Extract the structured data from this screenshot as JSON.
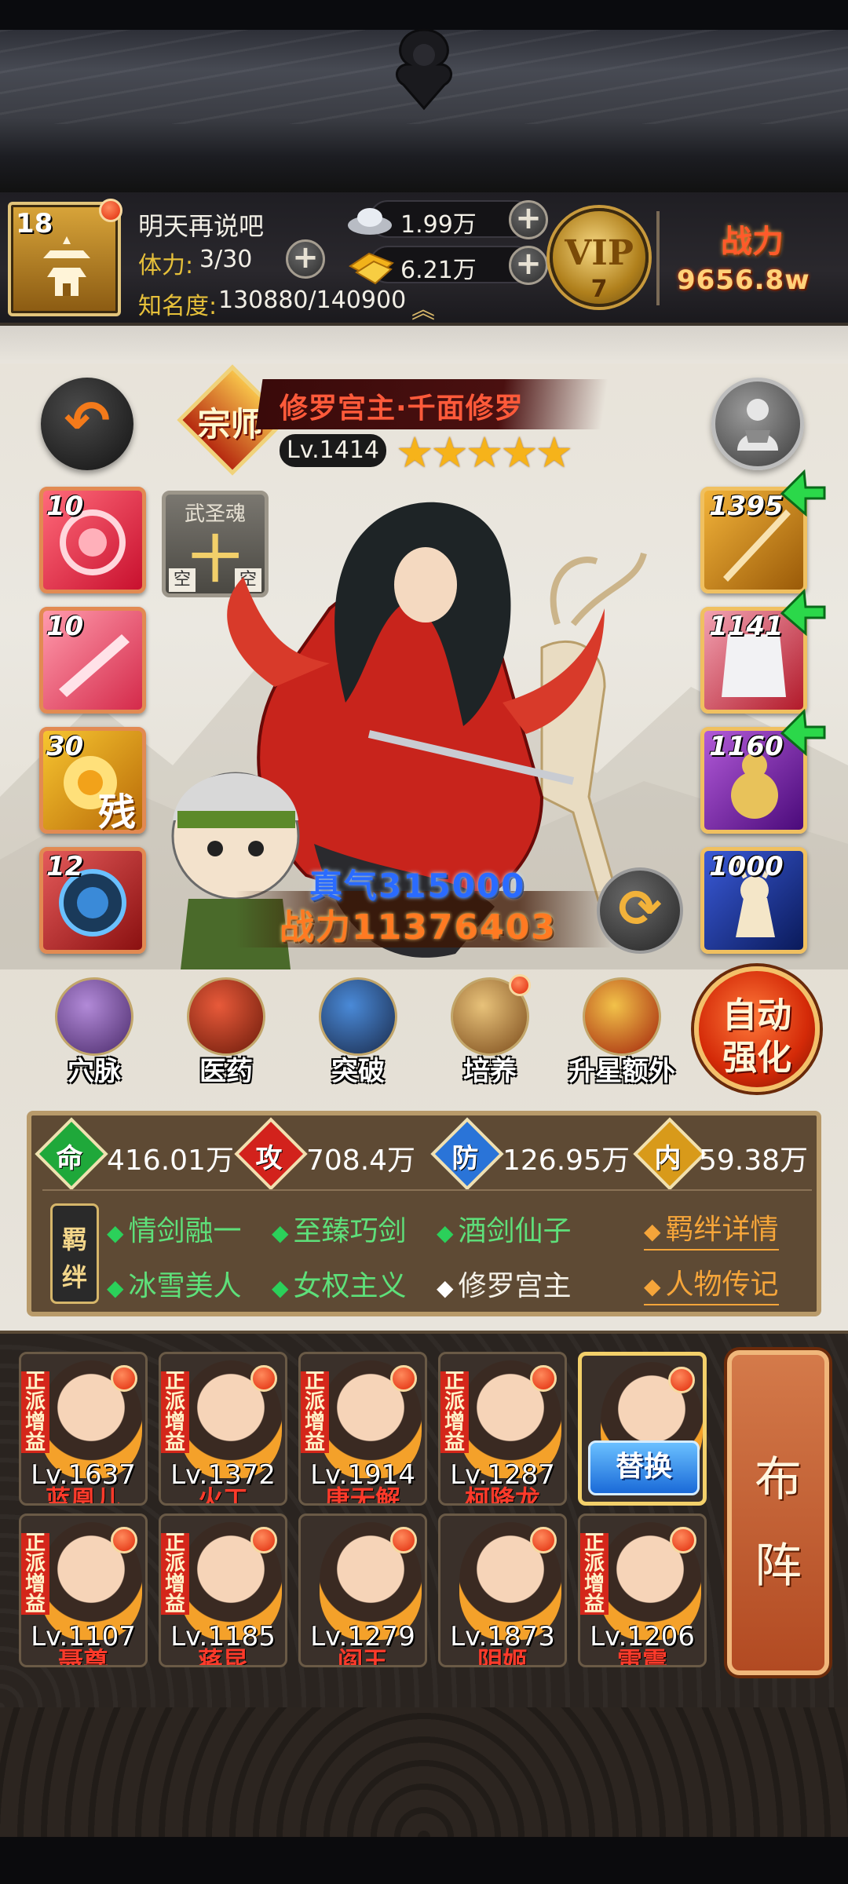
{
  "player": {
    "level": "18",
    "name": "明天再说吧",
    "stamina_label": "体力:",
    "stamina_value": "3/30",
    "fame_label": "知名度:",
    "fame_value": "130880/140900",
    "silver": "1.99万",
    "gold": "6.21万",
    "vip_text": "VIP",
    "vip_level": "7",
    "power_label": "战力",
    "power_value": "9656.8w"
  },
  "hero": {
    "rank_badge": "宗师",
    "name": "修罗宫主·千面修罗",
    "level": "Lv.1414",
    "stars": "★★★★★",
    "star_count": 5,
    "true_qi": "真气315000",
    "power": "战力11376403"
  },
  "left_slots": [
    {
      "num": "10",
      "mark": ""
    },
    {
      "num": "10",
      "mark": ""
    },
    {
      "num": "30",
      "mark": "残"
    },
    {
      "num": "12",
      "mark": ""
    }
  ],
  "martial_soul": {
    "title": "武圣魂",
    "char": "十",
    "left_key": "空",
    "right_key": "空"
  },
  "right_slots": [
    {
      "num": "1395",
      "upgrade": true
    },
    {
      "num": "1141",
      "upgrade": true
    },
    {
      "num": "1160",
      "upgrade": true
    },
    {
      "num": "1000",
      "upgrade": false
    }
  ],
  "actions": [
    {
      "label": "穴脉",
      "icon": "meridian-icon",
      "dot": false
    },
    {
      "label": "医药",
      "icon": "medicine-icon",
      "dot": false
    },
    {
      "label": "突破",
      "icon": "breakthrough-icon",
      "dot": false
    },
    {
      "label": "培养",
      "icon": "scroll-icon",
      "dot": true
    },
    {
      "label": "升星额外",
      "icon": "star-up-icon",
      "dot": false
    }
  ],
  "auto_enhance": {
    "line1": "自动",
    "line2": "强化"
  },
  "attributes": [
    {
      "icon": "命",
      "value": "416.01万",
      "color": "#1fa83a"
    },
    {
      "icon": "攻",
      "value": "708.4万",
      "color": "#d2221c"
    },
    {
      "icon": "防",
      "value": "126.95万",
      "color": "#2a74d8"
    },
    {
      "icon": "内",
      "value": "59.38万",
      "color": "#d89a1a"
    }
  ],
  "bonds_badge": {
    "c1": "羁",
    "c2": "绊"
  },
  "bonds": [
    {
      "name": "情剑融一",
      "active": true
    },
    {
      "name": "至臻巧剑",
      "active": true
    },
    {
      "name": "酒剑仙子",
      "active": true
    },
    {
      "name": "冰雪美人",
      "active": true
    },
    {
      "name": "女权主义",
      "active": true
    },
    {
      "name": "修罗宫主",
      "active": false
    }
  ],
  "links": {
    "bond_details": "羁绊详情",
    "biography": "人物传记"
  },
  "lineup": [
    {
      "lv": "Lv.1637",
      "name": "蓝凰儿",
      "tag": true
    },
    {
      "lv": "Lv.1372",
      "name": "火工",
      "tag": true
    },
    {
      "lv": "Lv.1914",
      "name": "唐无解",
      "tag": true
    },
    {
      "lv": "Lv.1287",
      "name": "柯降龙",
      "tag": true
    },
    {
      "lv": "",
      "name": "",
      "tag": false,
      "selected": true
    },
    {
      "lv": "Lv.1107",
      "name": "聂尊",
      "tag": true
    },
    {
      "lv": "Lv.1185",
      "name": "蒋昆",
      "tag": true
    },
    {
      "lv": "Lv.1279",
      "name": "阎王",
      "tag": false
    },
    {
      "lv": "Lv.1873",
      "name": "阴姬",
      "tag": false
    },
    {
      "lv": "Lv.1206",
      "name": "雷震",
      "tag": true
    }
  ],
  "tag_text": "正派增益",
  "replace_label": "替换",
  "formation": {
    "c1": "布",
    "c2": "阵"
  },
  "colors": {
    "accent_red": "#d2221c",
    "gold": "#f6b31a",
    "bond_green": "#5ee07a",
    "link_orange": "#f5a53a"
  }
}
